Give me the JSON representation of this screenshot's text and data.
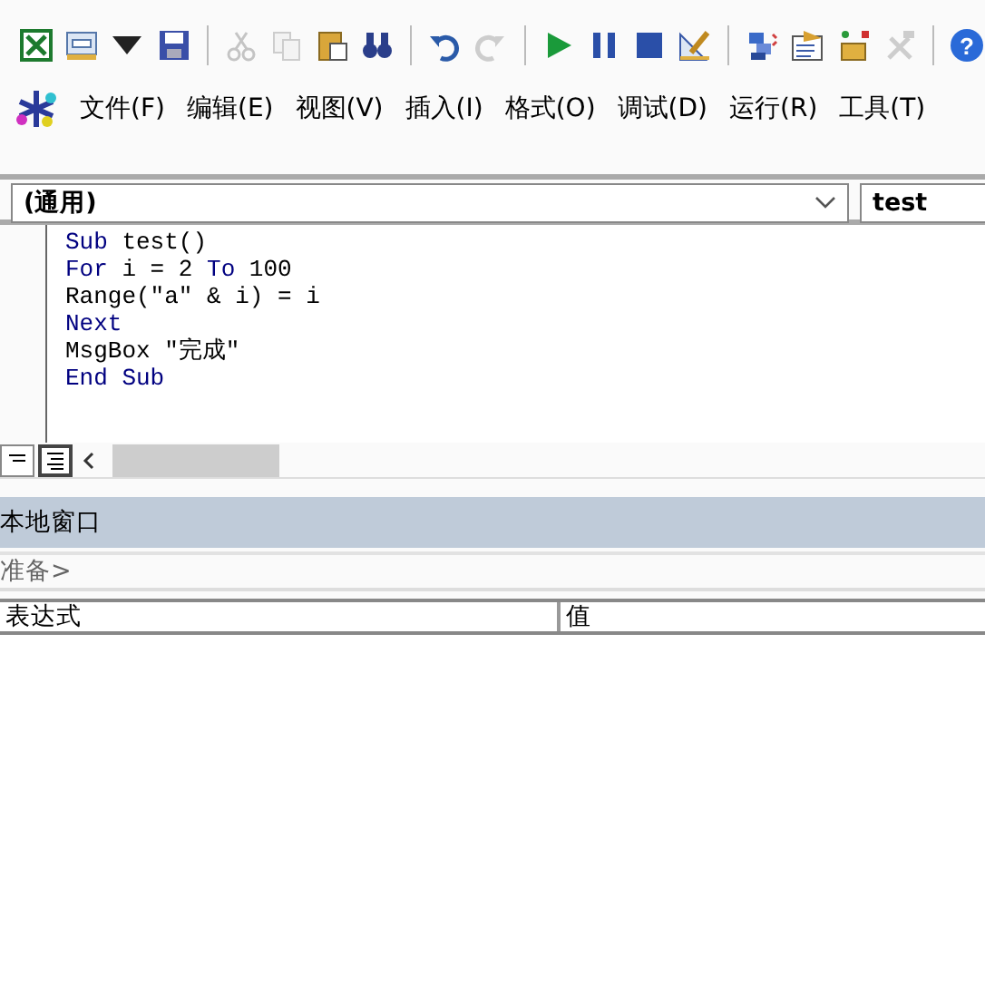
{
  "toolbar": [
    {
      "kind": "excel",
      "disabled": false
    },
    {
      "kind": "form",
      "disabled": false
    },
    {
      "kind": "caret",
      "disabled": false
    },
    {
      "kind": "save",
      "disabled": false
    },
    {
      "kind": "sep"
    },
    {
      "kind": "cut",
      "disabled": true
    },
    {
      "kind": "copy",
      "disabled": true
    },
    {
      "kind": "paste",
      "disabled": false
    },
    {
      "kind": "find",
      "disabled": false
    },
    {
      "kind": "sep"
    },
    {
      "kind": "undo",
      "disabled": false
    },
    {
      "kind": "redo",
      "disabled": true
    },
    {
      "kind": "sep"
    },
    {
      "kind": "run",
      "disabled": false
    },
    {
      "kind": "pause",
      "disabled": false
    },
    {
      "kind": "stop",
      "disabled": false
    },
    {
      "kind": "design",
      "disabled": false
    },
    {
      "kind": "sep"
    },
    {
      "kind": "project",
      "disabled": false
    },
    {
      "kind": "properties",
      "disabled": false
    },
    {
      "kind": "objects",
      "disabled": false
    },
    {
      "kind": "tools",
      "disabled": true
    },
    {
      "kind": "sep"
    },
    {
      "kind": "help",
      "disabled": false,
      "glyph": "?"
    }
  ],
  "menu": [
    "文件(F)",
    "编辑(E)",
    "视图(V)",
    "插入(I)",
    "格式(O)",
    "调试(D)",
    "运行(R)",
    "工具(T)"
  ],
  "object_combo": {
    "value": "(通用)"
  },
  "procedure_combo": {
    "value": "test"
  },
  "code_lines": [
    [
      {
        "text": "Sub",
        "kind": "keyword"
      },
      {
        "text": " test()",
        "kind": "plain"
      }
    ],
    [
      {
        "text": "For",
        "kind": "keyword"
      },
      {
        "text": " i = 2 ",
        "kind": "plain"
      },
      {
        "text": "To",
        "kind": "keyword"
      },
      {
        "text": " 100",
        "kind": "plain"
      }
    ],
    [
      {
        "text": "Range(\"a\" & i) = i",
        "kind": "plain"
      }
    ],
    [
      {
        "text": "Next",
        "kind": "keyword"
      }
    ],
    [
      {
        "text": "MsgBox \"完成\"",
        "kind": "plain"
      }
    ],
    [
      {
        "text": "End Sub",
        "kind": "keyword"
      }
    ]
  ],
  "view_buttons": [
    {
      "kind": "procedure",
      "selected": false
    },
    {
      "kind": "module",
      "selected": true
    }
  ],
  "locals_window": {
    "title": "本地窗口",
    "context": "准备>",
    "columns": [
      "表达式",
      "值"
    ]
  }
}
